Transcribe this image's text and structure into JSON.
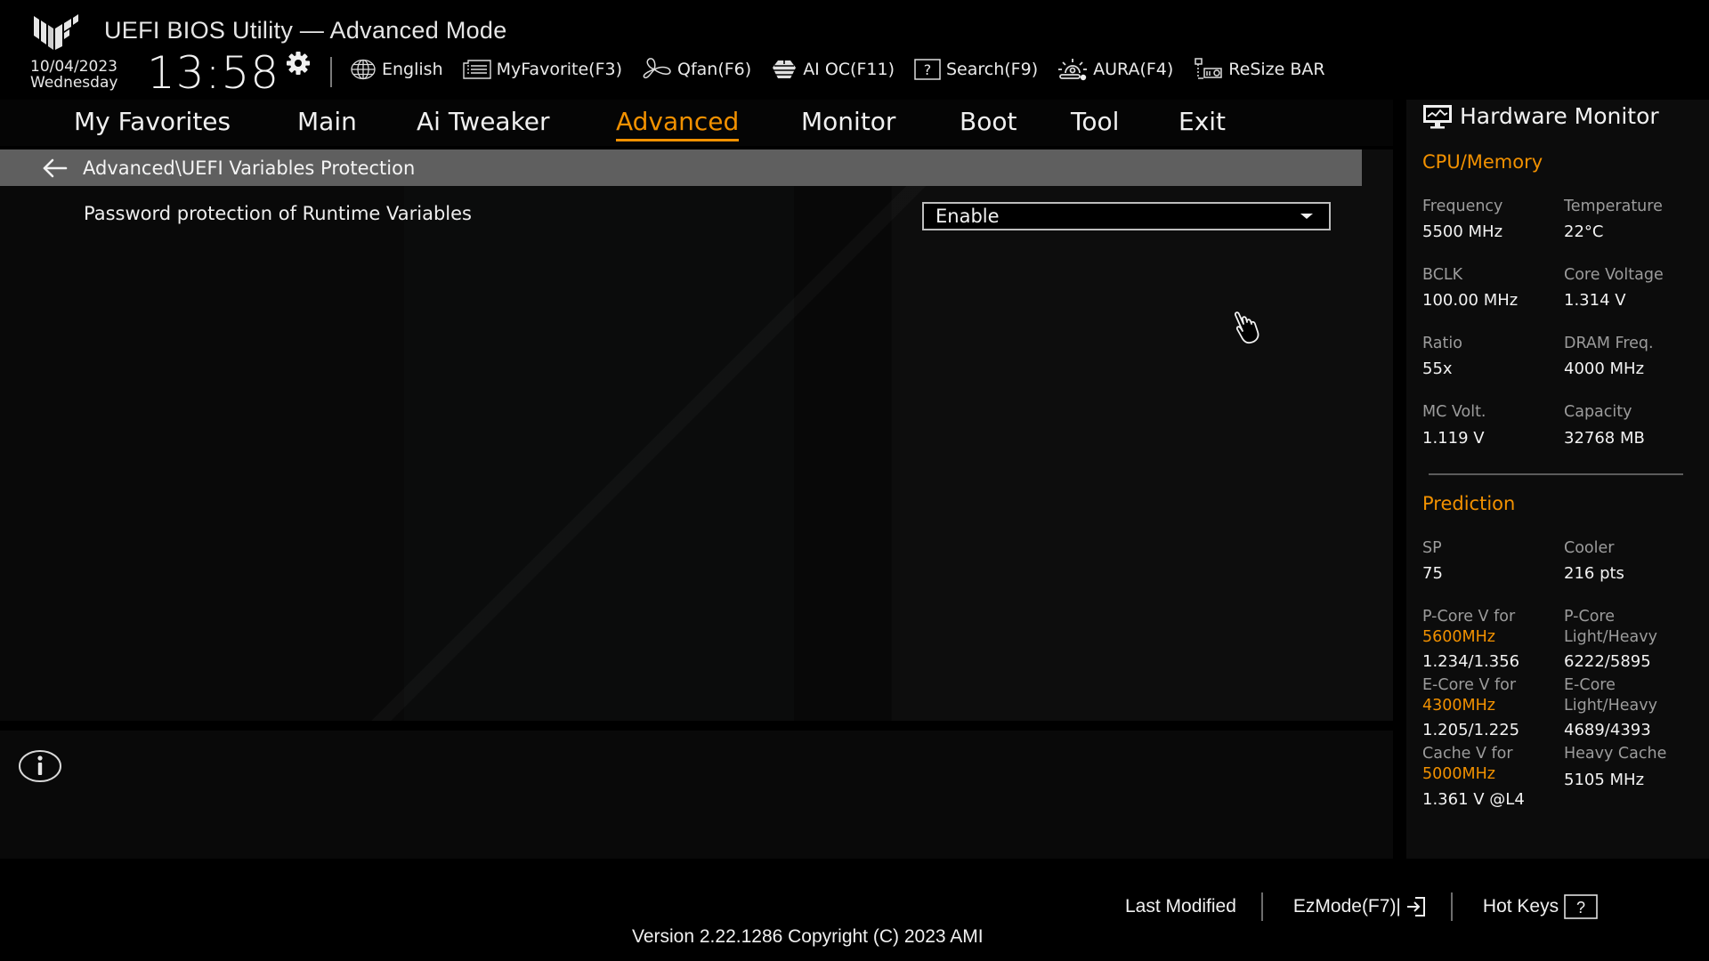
{
  "header": {
    "title": "UEFI BIOS Utility — Advanced Mode",
    "date": "10/04/2023",
    "weekday": "Wednesday",
    "time": "13:58"
  },
  "toolbar": [
    {
      "icon": "globe-icon",
      "label": "English"
    },
    {
      "icon": "favorite-list-icon",
      "label": "MyFavorite(F3)"
    },
    {
      "icon": "fan-icon",
      "label": "Qfan(F6)"
    },
    {
      "icon": "ai-oc-icon",
      "label": "AI OC(F11)"
    },
    {
      "icon": "search-help-icon",
      "label": "Search(F9)"
    },
    {
      "icon": "aura-light-icon",
      "label": "AURA(F4)"
    },
    {
      "icon": "resize-bar-icon",
      "label": "ReSize BAR"
    }
  ],
  "tabs": [
    {
      "label": "My Favorites",
      "active": false
    },
    {
      "label": "Main",
      "active": false
    },
    {
      "label": "Ai Tweaker",
      "active": false
    },
    {
      "label": "Advanced",
      "active": true
    },
    {
      "label": "Monitor",
      "active": false
    },
    {
      "label": "Boot",
      "active": false
    },
    {
      "label": "Tool",
      "active": false
    },
    {
      "label": "Exit",
      "active": false
    }
  ],
  "breadcrumb": "Advanced\\UEFI Variables Protection",
  "settings": [
    {
      "label": "Password protection of Runtime Variables",
      "value": "Enable"
    }
  ],
  "hardware_monitor": {
    "title": "Hardware Monitor",
    "cpu_memory": {
      "title": "CPU/Memory",
      "items": [
        {
          "label": "Frequency",
          "value": "5500 MHz"
        },
        {
          "label": "Temperature",
          "value": "22°C"
        },
        {
          "label": "BCLK",
          "value": "100.00 MHz"
        },
        {
          "label": "Core Voltage",
          "value": "1.314 V"
        },
        {
          "label": "Ratio",
          "value": "55x"
        },
        {
          "label": "DRAM Freq.",
          "value": "4000 MHz"
        },
        {
          "label": "MC Volt.",
          "value": "1.119 V"
        },
        {
          "label": "Capacity",
          "value": "32768 MB"
        }
      ]
    },
    "prediction": {
      "title": "Prediction",
      "sp_label": "SP",
      "sp_value": "75",
      "cooler_label": "Cooler",
      "cooler_value": "216 pts",
      "pcore_v_label": "P-Core V for",
      "pcore_v_freq": "5600MHz",
      "pcore_v_value": "1.234/1.356",
      "pcore_lh_label1": "P-Core",
      "pcore_lh_label2": "Light/Heavy",
      "pcore_lh_value": "6222/5895",
      "ecore_v_label": "E-Core V for",
      "ecore_v_freq": "4300MHz",
      "ecore_v_value": "1.205/1.225",
      "ecore_lh_label1": "E-Core",
      "ecore_lh_label2": "Light/Heavy",
      "ecore_lh_value": "4689/4393",
      "cache_v_label": "Cache V for",
      "cache_v_freq": "5000MHz",
      "cache_v_value": "1.361 V @L4",
      "heavy_cache_label": "Heavy Cache",
      "heavy_cache_value": "5105 MHz"
    }
  },
  "footer": {
    "last_modified": "Last Modified",
    "ezmode": "EzMode(F7)|",
    "hotkeys": "Hot Keys",
    "version": "Version 2.22.1286 Copyright (C) 2023 AMI"
  },
  "colors": {
    "accent": "#f29100",
    "breadcrumb_bg": "#5f5f5f",
    "label_gray": "#9c9c9c"
  }
}
